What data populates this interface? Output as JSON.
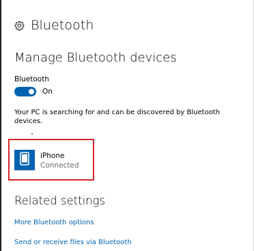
{
  "header": {
    "icon": "gear-icon",
    "title": "Bluetooth"
  },
  "manage": {
    "title": "Manage Bluetooth devices",
    "toggle_label": "Bluetooth",
    "toggle_state": "On",
    "toggle_on": true,
    "discover_text": "Your PC is searching for and can be discovered by Bluetooth devices."
  },
  "device": {
    "icon": "phone-icon",
    "name": "iPhone",
    "status": "Connected"
  },
  "related": {
    "title": "Related settings",
    "links": [
      "More Bluetooth options",
      "Send or receive files via Bluetooth"
    ]
  },
  "colors": {
    "accent": "#0063b1",
    "highlight": "#d7262c",
    "secondary_text": "#6b6b6b"
  }
}
